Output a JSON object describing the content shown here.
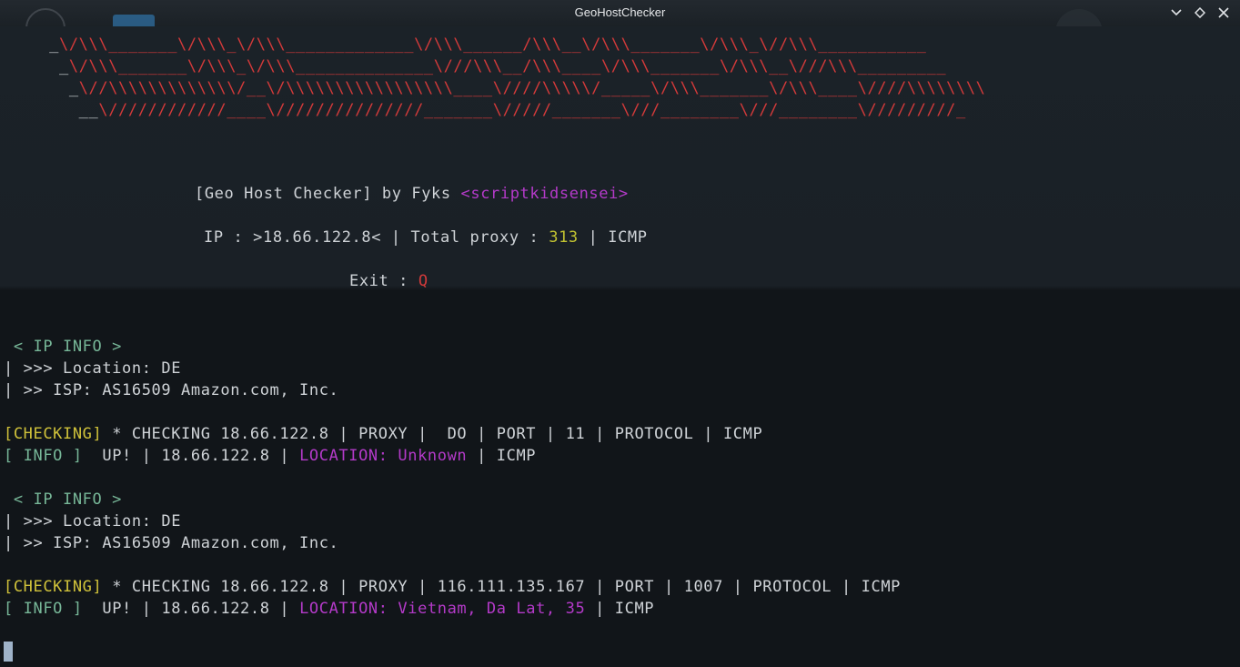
{
  "window": {
    "title": "GeoHostChecker",
    "controls": [
      "chevron-down",
      "restore",
      "close"
    ]
  },
  "banner": {
    "lines": [
      {
        "prefix": "     _",
        "art": "\\/\\\\\\_______\\/\\\\\\_\\/\\\\\\_____________\\/\\\\\\______/\\\\\\__\\/\\\\\\_______\\/\\\\\\_\\//\\\\\\___________"
      },
      {
        "prefix": "      _",
        "art": "\\/\\\\\\_______\\/\\\\\\_\\/\\\\\\______________\\///\\\\\\__/\\\\\\____\\/\\\\\\_______\\/\\\\\\__\\///\\\\\\_________"
      },
      {
        "prefix": "       _",
        "art": "\\//\\\\\\\\\\\\\\\\\\\\\\\\\\/__\\/\\\\\\\\\\\\\\\\\\\\\\\\\\\\\\\\\\____\\////\\\\\\\\\\/_____\\/\\\\\\_______\\/\\\\\\____\\////\\\\\\\\\\\\\\\\"
      },
      {
        "prefix": "        __",
        "art": "\\////////////____\\///////////////_______\\/////_______\\///________\\///________\\/////////_"
      }
    ]
  },
  "header": {
    "title_prefix": "[Geo Host Checker] by Fyks ",
    "author": "<scriptkidsensei>",
    "ip_prefix": "IP : >18.66.122.8< | Total proxy : ",
    "total_proxy": "313",
    "ip_suffix": " | ICMP",
    "exit_label": "Exit : ",
    "exit_key": "Q"
  },
  "entries": [
    {
      "info_title": " < IP INFO >",
      "location": "| >>> Location: DE",
      "isp": "| >> ISP: AS16509 Amazon.com, Inc.",
      "check_tag": "[CHECKING]",
      "check_text": " * CHECKING 18.66.122.8 | PROXY |  DO | PORT | 11 | PROTOCOL | ICMP",
      "info_tag": "[ INFO ]",
      "up_text": "  UP! | 18.66.122.8 | ",
      "location_result": "LOCATION: Unknown",
      "proto": " | ICMP"
    },
    {
      "info_title": " < IP INFO >",
      "location": "| >>> Location: DE",
      "isp": "| >> ISP: AS16509 Amazon.com, Inc.",
      "check_tag": "[CHECKING]",
      "check_text": " * CHECKING 18.66.122.8 | PROXY | 116.111.135.167 | PORT | 1007 | PROTOCOL | ICMP",
      "info_tag": "[ INFO ]",
      "up_text": "  UP! | 18.66.122.8 | ",
      "location_result": "LOCATION: Vietnam, Da Lat, 35",
      "proto": " | ICMP"
    }
  ],
  "colors": {
    "ascii_red": "#d23a3a",
    "author_purple": "#b43ac9",
    "count_yellow": "#c2c331",
    "info_green": "#77b798",
    "checking_gold": "#d0c23a"
  }
}
